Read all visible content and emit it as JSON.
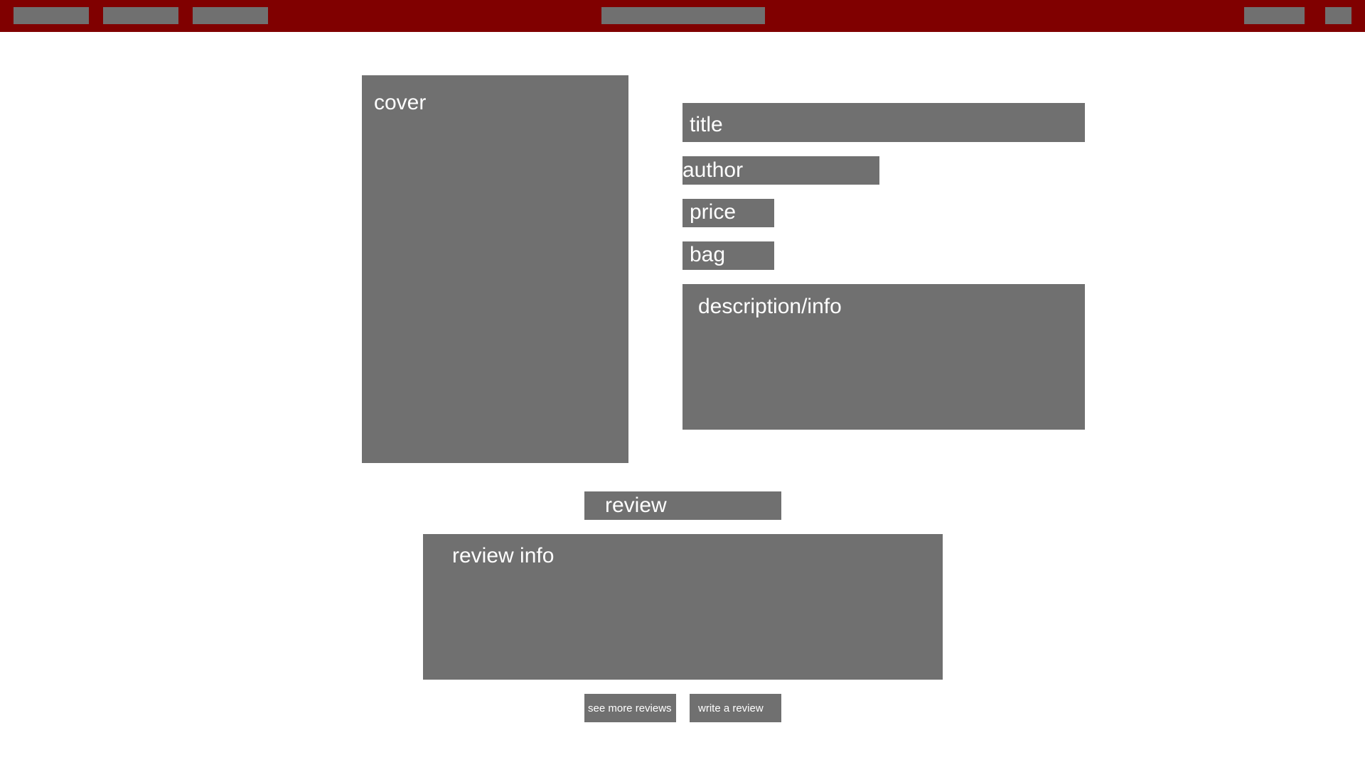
{
  "colors": {
    "navbar": "#800000",
    "placeholder": "#707070",
    "text": "#ffffff",
    "background": "#ffffff"
  },
  "product": {
    "cover_label": "cover",
    "title_label": "title",
    "author_label": "author",
    "price_label": "price",
    "bag_label": "bag",
    "description_label": "description/info"
  },
  "reviews": {
    "heading_label": "review",
    "info_label": "review info",
    "see_more_label": "see more reviews",
    "write_label": "write a review"
  }
}
